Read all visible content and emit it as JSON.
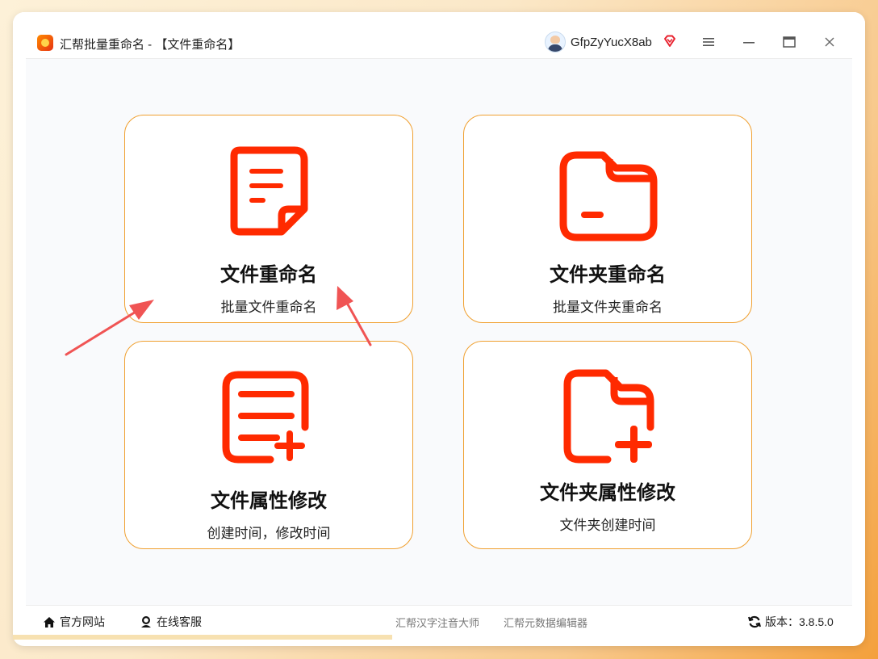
{
  "window": {
    "title": "汇帮批量重命名 - 【文件重命名】",
    "username": "GfpZyYucX8ab"
  },
  "cards": [
    {
      "title": "文件重命名",
      "subtitle": "批量文件重命名"
    },
    {
      "title": "文件夹重命名",
      "subtitle": "批量文件夹重命名"
    },
    {
      "title": "文件属性修改",
      "subtitle": "创建时间，修改时间"
    },
    {
      "title": "文件夹属性修改",
      "subtitle": "文件夹创建时间"
    }
  ],
  "footer": {
    "website": "官方网站",
    "support": "在线客服",
    "link_pinyin": "汇帮汉字注音大师",
    "link_metadata": "汇帮元数据编辑器",
    "version": "版本：3.8.5.0"
  },
  "colors": {
    "accent": "#ff2a00",
    "card_border": "#f0a030",
    "annotation_arrow": "#f05454"
  }
}
